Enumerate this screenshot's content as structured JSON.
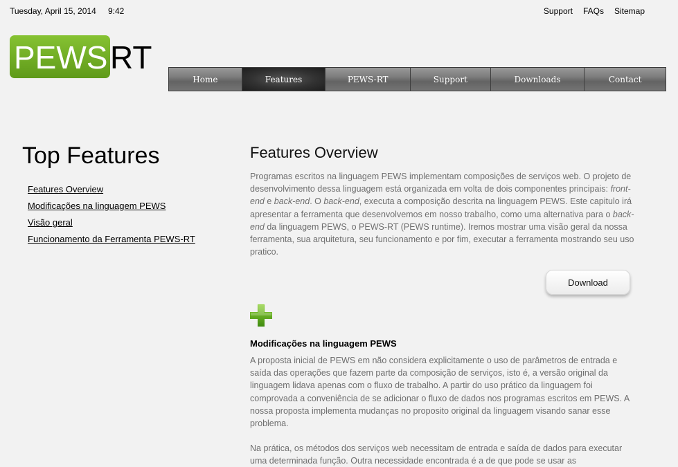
{
  "topbar": {
    "date": "Tuesday, April 15, 2014",
    "time": "9:42",
    "links": [
      "Support",
      "FAQs",
      "Sitemap"
    ]
  },
  "logo": {
    "part1": "PEWS",
    "part2": "RT",
    "accent_color": "#6aa824"
  },
  "nav": {
    "items": [
      "Home",
      "Features",
      "PEWS-RT",
      "Support",
      "Downloads",
      "Contact"
    ],
    "active": "Features"
  },
  "sidebar": {
    "title": "Top Features",
    "links": [
      "Features Overview",
      "Modificações na linguagem PEWS",
      "Visão geral",
      "Funcionamento da Ferramenta PEWS-RT"
    ]
  },
  "main": {
    "title": "Features Overview",
    "intro": {
      "t1": "Programas escritos na linguagem PEWS implementam composições de serviços web. O projeto de desenvolvimento dessa linguagem está organizada em volta de dois componentes principais: ",
      "e1": "front-end",
      "t2": " e ",
      "e2": "back-end",
      "t3": ". O ",
      "e3": "back-end",
      "t4": ", executa a composição descrita na linguagem PEWS. Este capitulo irá apresentar a ferramenta que desenvolvemos em nosso trabalho, como uma alternativa para o ",
      "e4": "back-end",
      "t5": " da linguagem PEWS, o PEWS-RT (PEWS runtime). Iremos mostrar uma visão geral da nossa ferramenta, sua arquitetura, seu funcionamento e por fim, executar a ferramenta mostrando seu uso pratico."
    },
    "download_label": "Download",
    "plus_icon": "plus-icon",
    "section_title": "Modificações na linguagem PEWS",
    "section_p1": "A proposta inicial de PEWS em não considera explicitamente o uso de parâmetros de entrada e saída das operações que fazem parte da composição de serviços, isto é, a versão original da linguagem lidava apenas com o fluxo de trabalho. A partir do uso prático da linguagem foi comprovada a conveniência de se adicionar o fluxo de dados nos programas escritos em PEWS. A nossa proposta implementa mudanças no proposito original da linguagem visando sanar esse problema.",
    "section_p2": "Na prática, os métodos dos serviços web necessitam de entrada e saída de dados para executar uma determinada função. Outra necessidade encontrada é a de que pode se usar as"
  }
}
